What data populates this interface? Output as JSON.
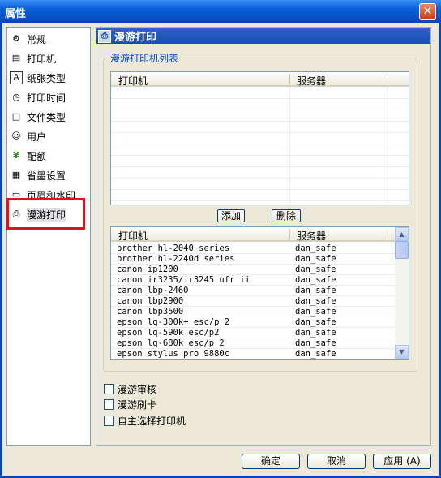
{
  "window": {
    "title": "属性",
    "close_glyph": "✕"
  },
  "sidebar": {
    "items": [
      {
        "label": "常规",
        "icon": "gear-icon",
        "glyph": "⚙"
      },
      {
        "label": "打印机",
        "icon": "printer-icon",
        "glyph": "▤"
      },
      {
        "label": "纸张类型",
        "icon": "paper-type-icon",
        "glyph": "A"
      },
      {
        "label": "打印时间",
        "icon": "clock-icon",
        "glyph": "◷"
      },
      {
        "label": "文件类型",
        "icon": "file-icon",
        "glyph": "□"
      },
      {
        "label": "用户",
        "icon": "user-icon",
        "glyph": "☺"
      },
      {
        "label": "配额",
        "icon": "quota-icon",
        "glyph": "¥"
      },
      {
        "label": "省墨设置",
        "icon": "ink-save-icon",
        "glyph": "▦"
      },
      {
        "label": "页眉和水印",
        "icon": "header-watermark-icon",
        "glyph": "▭"
      },
      {
        "label": "漫游打印",
        "icon": "roaming-print-icon",
        "glyph": "⎙"
      }
    ],
    "selected": "漫游打印"
  },
  "panel": {
    "title": "漫游打印",
    "group_label": "漫游打印机列表",
    "top_list": {
      "col_printer": "打印机",
      "col_server": "服务器",
      "rows": []
    },
    "add_button": "添加",
    "delete_button": "删除",
    "bottom_list": {
      "col_printer": "打印机",
      "col_server": "服务器",
      "rows": [
        {
          "printer": "brother hl-2040 series",
          "server": "dan_safe"
        },
        {
          "printer": "brother hl-2240d series",
          "server": "dan_safe"
        },
        {
          "printer": "canon ip1200",
          "server": "dan_safe"
        },
        {
          "printer": "canon ir3235/ir3245 ufr ii",
          "server": "dan_safe"
        },
        {
          "printer": "canon lbp-2460",
          "server": "dan_safe"
        },
        {
          "printer": "canon lbp2900",
          "server": "dan_safe"
        },
        {
          "printer": "canon lbp3500",
          "server": "dan_safe"
        },
        {
          "printer": "epson lq-300k+ esc/p 2",
          "server": "dan_safe"
        },
        {
          "printer": "epson lq-590k esc/p2",
          "server": "dan_safe"
        },
        {
          "printer": "epson lq-680k esc/p 2",
          "server": "dan_safe"
        },
        {
          "printer": "epson stylus pro 9880c",
          "server": "dan_safe"
        }
      ]
    },
    "checkboxes": [
      {
        "label": "漫游审核",
        "checked": false
      },
      {
        "label": "漫游刷卡",
        "checked": false
      },
      {
        "label": "自主选择打印机",
        "checked": false
      }
    ]
  },
  "footer": {
    "ok_button": "确定",
    "cancel_button": "取消",
    "apply_button": "应用 (A)"
  },
  "colors": {
    "titlebar": "#0a5fd8",
    "highlight": "#e0141e",
    "group_label": "#0046d5"
  }
}
